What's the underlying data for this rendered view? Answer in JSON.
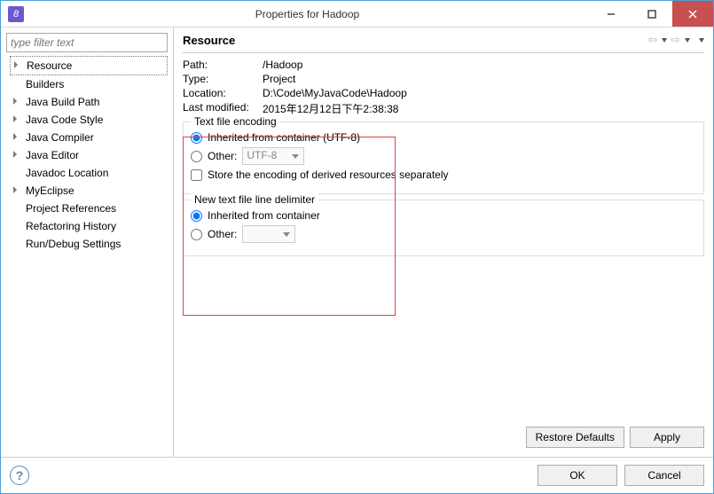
{
  "window": {
    "title": "Properties for Hadoop"
  },
  "sidebar": {
    "filter_placeholder": "type filter text",
    "items": [
      "Resource",
      "Builders",
      "Java Build Path",
      "Java Code Style",
      "Java Compiler",
      "Java Editor",
      "Javadoc Location",
      "MyEclipse",
      "Project References",
      "Refactoring History",
      "Run/Debug Settings"
    ],
    "selected_index": 0
  },
  "main": {
    "title": "Resource",
    "props": {
      "path_label": "Path:",
      "path_value": "/Hadoop",
      "type_label": "Type:",
      "type_value": "Project",
      "location_label": "Location:",
      "location_value": "D:\\Code\\MyJavaCode\\Hadoop",
      "modified_label": "Last modified:",
      "modified_value": "2015年12月12日下午2:38:38"
    },
    "encoding": {
      "legend": "Text file encoding",
      "inherited_label": "Inherited from container (UTF-8)",
      "other_label": "Other:",
      "other_value": "UTF-8",
      "store_derived_label": "Store the encoding of derived resources separately",
      "selected": "inherited"
    },
    "delimiter": {
      "legend": "New text file line delimiter",
      "inherited_label": "Inherited from container",
      "other_label": "Other:",
      "other_value": "",
      "selected": "inherited"
    },
    "buttons": {
      "restore": "Restore Defaults",
      "apply": "Apply"
    }
  },
  "footer": {
    "ok": "OK",
    "cancel": "Cancel"
  }
}
